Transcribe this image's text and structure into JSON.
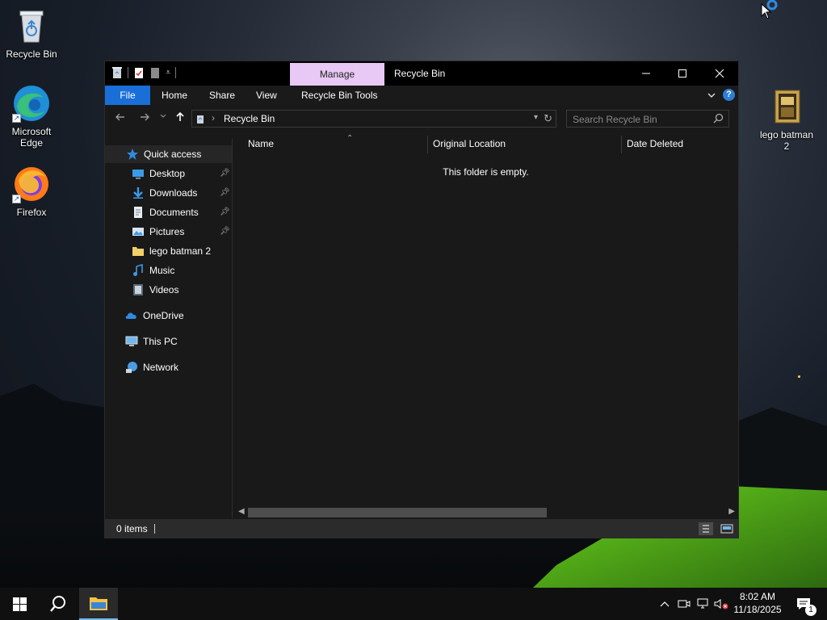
{
  "desktop": {
    "icons": [
      {
        "label": "Recycle Bin",
        "icon": "recycle-bin-icon"
      },
      {
        "label": "Microsoft Edge",
        "icon": "edge-icon"
      },
      {
        "label": "Firefox",
        "icon": "firefox-icon"
      },
      {
        "label": "lego batman 2",
        "icon": "game-folder-icon"
      }
    ]
  },
  "window": {
    "title": "Recycle Bin",
    "contextual_tab": "Manage",
    "ribbon_tabs": [
      "File",
      "Home",
      "Share",
      "View",
      "Recycle Bin Tools"
    ],
    "address_path": "Recycle Bin",
    "search_placeholder": "Search Recycle Bin",
    "columns": [
      "Name",
      "Original Location",
      "Date Deleted"
    ],
    "empty_message": "This folder is empty.",
    "status": "0 items",
    "accent": "#1a6ed8",
    "contextual_tab_color": "#e8c8f5"
  },
  "nav_pane": {
    "quick_access": "Quick access",
    "pinned": [
      {
        "label": "Desktop",
        "icon": "desktop-icon",
        "pinned": true
      },
      {
        "label": "Downloads",
        "icon": "download-icon",
        "pinned": true
      },
      {
        "label": "Documents",
        "icon": "document-icon",
        "pinned": true
      },
      {
        "label": "Pictures",
        "icon": "picture-icon",
        "pinned": true
      },
      {
        "label": "lego batman 2",
        "icon": "folder-icon",
        "pinned": false
      },
      {
        "label": "Music",
        "icon": "music-icon",
        "pinned": false
      },
      {
        "label": "Videos",
        "icon": "video-icon",
        "pinned": false
      }
    ],
    "onedrive": "OneDrive",
    "this_pc": "This PC",
    "network": "Network"
  },
  "taskbar": {
    "time": "8:02 AM",
    "date": "11/18/2025",
    "notification_count": "1"
  }
}
